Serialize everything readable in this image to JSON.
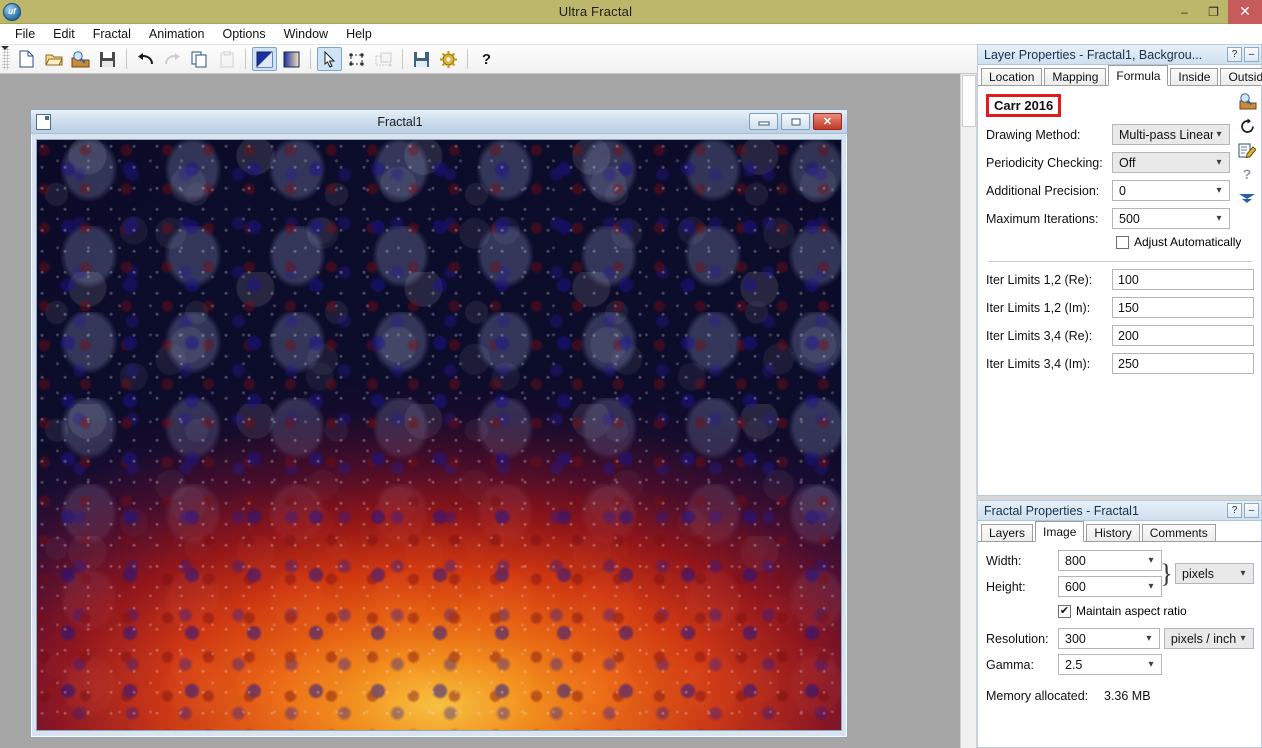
{
  "window": {
    "title": "Ultra Fractal",
    "app_icon": "uf",
    "controls": {
      "minimize": "–",
      "restore": "❐",
      "close": "✕"
    }
  },
  "menubar": {
    "items": [
      "File",
      "Edit",
      "Fractal",
      "Animation",
      "Options",
      "Window",
      "Help"
    ]
  },
  "toolbar": {
    "buttons": [
      {
        "name": "new-icon",
        "label": "New",
        "state": "normal"
      },
      {
        "name": "open-icon",
        "label": "Open",
        "state": "normal"
      },
      {
        "name": "browse-icon",
        "label": "Browse",
        "state": "normal"
      },
      {
        "name": "save-icon",
        "label": "Save",
        "state": "normal"
      },
      {
        "name": "undo-icon",
        "label": "Undo",
        "state": "normal"
      },
      {
        "name": "redo-icon",
        "label": "Redo",
        "state": "disabled"
      },
      {
        "name": "copy-icon",
        "label": "Copy",
        "state": "normal"
      },
      {
        "name": "paste-icon",
        "label": "Paste",
        "state": "disabled"
      },
      {
        "name": "fractal-window-icon",
        "label": "Fractal Window",
        "state": "active"
      },
      {
        "name": "gradient-icon",
        "label": "Gradient",
        "state": "normal"
      },
      {
        "name": "select-tool-icon",
        "label": "Select",
        "state": "active"
      },
      {
        "name": "mask-tool-icon",
        "label": "Mask",
        "state": "normal"
      },
      {
        "name": "add-layer-icon",
        "label": "Add Layer",
        "state": "disabled"
      },
      {
        "name": "render-to-disk-icon",
        "label": "Render to Disk",
        "state": "normal"
      },
      {
        "name": "options-icon",
        "label": "Options",
        "state": "normal"
      },
      {
        "name": "help-icon",
        "label": "?",
        "state": "normal"
      }
    ],
    "help_glyph": "?"
  },
  "fractal_window": {
    "title": "Fractal1",
    "controls": {
      "minimize": "–",
      "restore": "□",
      "close": "✕"
    }
  },
  "layer_properties": {
    "title": "Layer Properties - Fractal1, Backgrou...",
    "help_glyph": "?",
    "minimize_glyph": "–",
    "tabs": [
      {
        "label": "Location",
        "selected": false
      },
      {
        "label": "Mapping",
        "selected": false
      },
      {
        "label": "Formula",
        "selected": true
      },
      {
        "label": "Inside",
        "selected": false
      },
      {
        "label": "Outside",
        "selected": false
      }
    ],
    "formula_name": "Carr 2016",
    "fields": [
      {
        "label": "Drawing Method:",
        "value": "Multi-pass Linear",
        "type": "combo"
      },
      {
        "label": "Periodicity Checking:",
        "value": "Off",
        "type": "combo"
      },
      {
        "label": "Additional Precision:",
        "value": "0",
        "type": "combo"
      },
      {
        "label": "Maximum Iterations:",
        "value": "500",
        "type": "combo"
      }
    ],
    "adjust_automatically": {
      "label": "Adjust Automatically",
      "checked": false,
      "mark": ""
    },
    "iter_limits": [
      {
        "label": "Iter Limits 1,2 (Re):",
        "value": "100"
      },
      {
        "label": "Iter Limits 1,2 (Im):",
        "value": "150"
      },
      {
        "label": "Iter Limits 3,4 (Re):",
        "value": "200"
      },
      {
        "label": "Iter Limits 3,4 (Im):",
        "value": "250"
      }
    ],
    "side_icons": [
      {
        "name": "browse-formula-icon",
        "glyph": ""
      },
      {
        "name": "reload-formula-icon",
        "glyph": "⟳"
      },
      {
        "name": "edit-formula-icon",
        "glyph": ""
      },
      {
        "name": "help-field-icon",
        "glyph": "?"
      },
      {
        "name": "expand-iterations-icon",
        "glyph": "▽"
      }
    ]
  },
  "fractal_properties": {
    "title": "Fractal Properties - Fractal1",
    "help_glyph": "?",
    "minimize_glyph": "–",
    "tabs": [
      {
        "label": "Layers",
        "selected": false
      },
      {
        "label": "Image",
        "selected": true
      },
      {
        "label": "History",
        "selected": false
      },
      {
        "label": "Comments",
        "selected": false
      }
    ],
    "width": {
      "label": "Width:",
      "value": "800"
    },
    "height": {
      "label": "Height:",
      "value": "600"
    },
    "size_unit": {
      "value": "pixels"
    },
    "maintain_aspect_ratio": {
      "label": "Maintain aspect ratio",
      "checked": true,
      "mark": "✔"
    },
    "resolution": {
      "label": "Resolution:",
      "value": "300"
    },
    "resolution_unit": {
      "value": "pixels / inch"
    },
    "gamma": {
      "label": "Gamma:",
      "value": "2.5"
    },
    "memory": {
      "label": "Memory allocated:",
      "value": "3.36 MB"
    }
  },
  "colors": {
    "titlebar": "#bdb76b",
    "close_button": "#c75b5b",
    "highlight_box": "#e01b1b",
    "panel_header": "#cfe0ef",
    "workspace": "#a6a6a6",
    "fractal_blue": "#2626c4",
    "fractal_orange": "#f86808"
  }
}
